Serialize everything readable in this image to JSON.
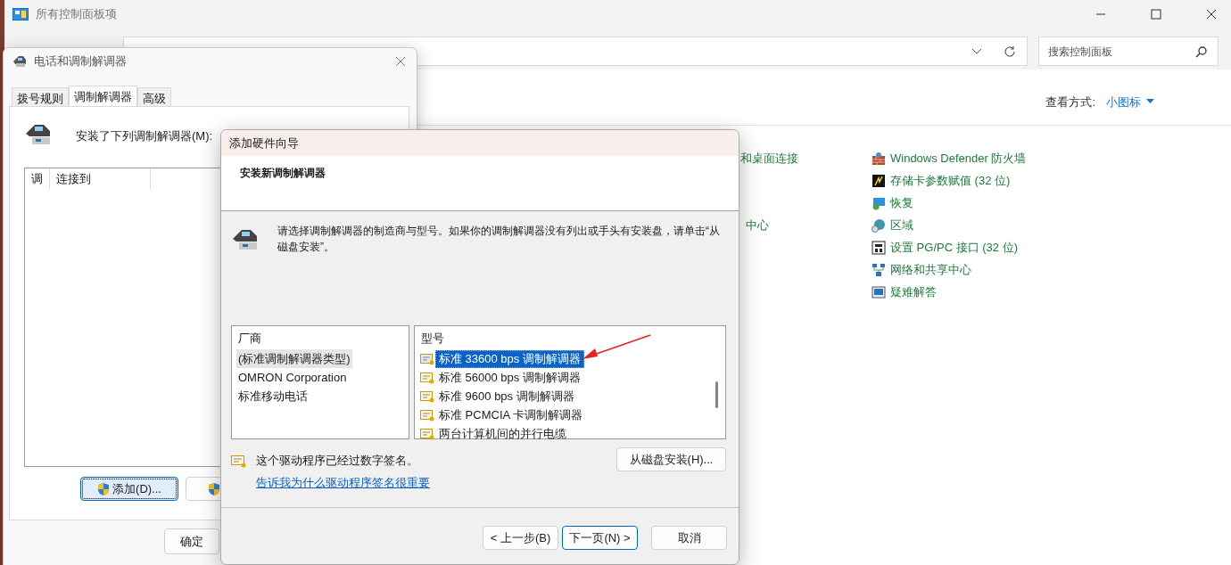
{
  "control_panel": {
    "title": "所有控制面板项",
    "search": {
      "placeholder": "搜索控制面板"
    },
    "view_by": {
      "label": "查看方式:",
      "value": "小图标"
    },
    "partial_items": [
      {
        "label": "和桌面连接"
      },
      {
        "label": "中心"
      }
    ],
    "items": [
      {
        "label": "Windows Defender 防火墙"
      },
      {
        "label": "存储卡参数赋值 (32 位)"
      },
      {
        "label": "恢复"
      },
      {
        "label": "区域"
      },
      {
        "label": "设置 PG/PC 接口 (32 位)"
      },
      {
        "label": "网络和共享中心"
      },
      {
        "label": "疑难解答"
      }
    ]
  },
  "phone_dialog": {
    "title": "电话和调制解调器",
    "tabs": [
      {
        "label": "拨号规则",
        "selected": false
      },
      {
        "label": "调制解调器",
        "selected": true
      },
      {
        "label": "高级",
        "selected": false
      }
    ],
    "list_label": "安装了下列调制解调器(M):",
    "columns": [
      "调",
      "连接到"
    ],
    "buttons": [
      {
        "label": "添加(D)...",
        "focused": true
      },
      {
        "focused": false
      }
    ],
    "ok_button": "确定"
  },
  "wizard": {
    "title": "添加硬件向导",
    "heading": "安装新调制解调器",
    "description": "请选择调制解调器的制造商与型号。如果你的调制解调器没有列出或手头有安装盘，请单击“从磁盘安装”。",
    "manufacturers": {
      "header": "厂商",
      "items": [
        {
          "label": "(标准调制解调器类型)",
          "selected": true
        },
        {
          "label": "OMRON Corporation",
          "selected": false
        },
        {
          "label": "标准移动电话",
          "selected": false
        }
      ]
    },
    "models": {
      "header": "型号",
      "items": [
        {
          "label": "标准 33600 bps 调制解调器",
          "selected": true
        },
        {
          "label": "标准 56000 bps 调制解调器",
          "selected": false
        },
        {
          "label": "标准 9600 bps 调制解调器",
          "selected": false
        },
        {
          "label": "标准 PCMCIA 卡调制解调器",
          "selected": false
        },
        {
          "label": "两台计算机间的并行电缆",
          "selected": false
        }
      ]
    },
    "signed_text": "这个驱动程序已经过数字签名。",
    "link": "告诉我为什么驱动程序签名很重要",
    "disk_button": "从磁盘安装(H)...",
    "buttons": [
      {
        "label": "< 上一步(B)",
        "default": false
      },
      {
        "label": "下一页(N) >",
        "default": true
      },
      {
        "label": "取消",
        "default": false
      }
    ]
  }
}
